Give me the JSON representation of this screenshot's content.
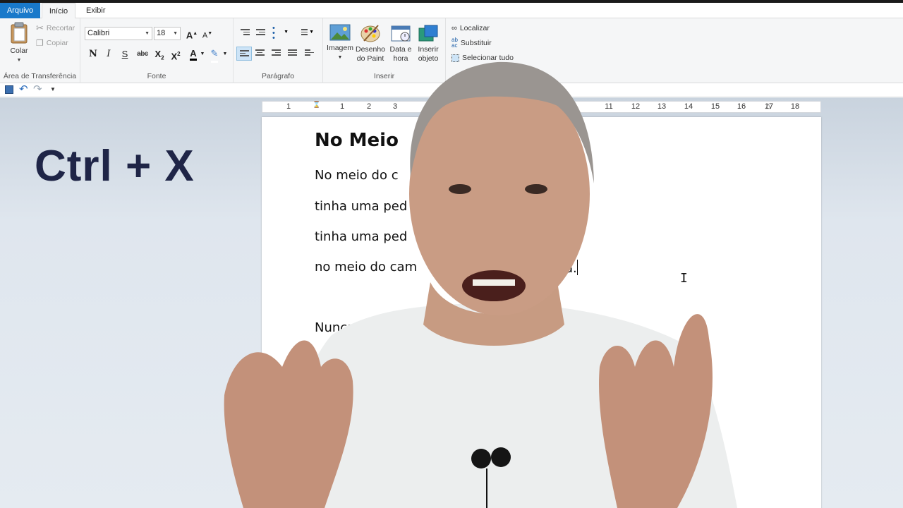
{
  "tabs": {
    "file": "Arquivo",
    "home": "Início",
    "view": "Exibir"
  },
  "clipboard": {
    "paste": "Colar",
    "cut": "Recortar",
    "copy": "Copiar",
    "label": "Área de Transferência"
  },
  "font": {
    "family": "Calibri",
    "size": "18",
    "bold": "N",
    "italic": "I",
    "underline": "S",
    "strike": "abc",
    "label": "Fonte"
  },
  "paragraph": {
    "label": "Parágrafo"
  },
  "insert": {
    "image": "Imagem",
    "paint_line1": "Desenho",
    "paint_line2": "do Paint",
    "datetime_line1": "Data e",
    "datetime_line2": "hora",
    "object_line1": "Inserir",
    "object_line2": "objeto",
    "label": "Inserir"
  },
  "editing": {
    "find": "Localizar",
    "replace": "Substituir",
    "select_all": "Selecionar tudo"
  },
  "ruler": {
    "numbers": [
      "1",
      "1",
      "2",
      "3",
      "11",
      "12",
      "13",
      "14",
      "15",
      "16",
      "17",
      "18"
    ]
  },
  "document": {
    "title": "No Meio",
    "line1": "No meio do c",
    "line2": "tinha uma ped",
    "line3": "tinha uma ped",
    "line4_start": "no meio do cam",
    "line4_end": "a.",
    "line5": "Nunca m"
  },
  "overlay": {
    "shortcut": "Ctrl + X"
  },
  "colors": {
    "file_tab": "#1979ca",
    "shortcut_text": "#1f2547",
    "ribbon_bg": "#f5f6f7"
  }
}
